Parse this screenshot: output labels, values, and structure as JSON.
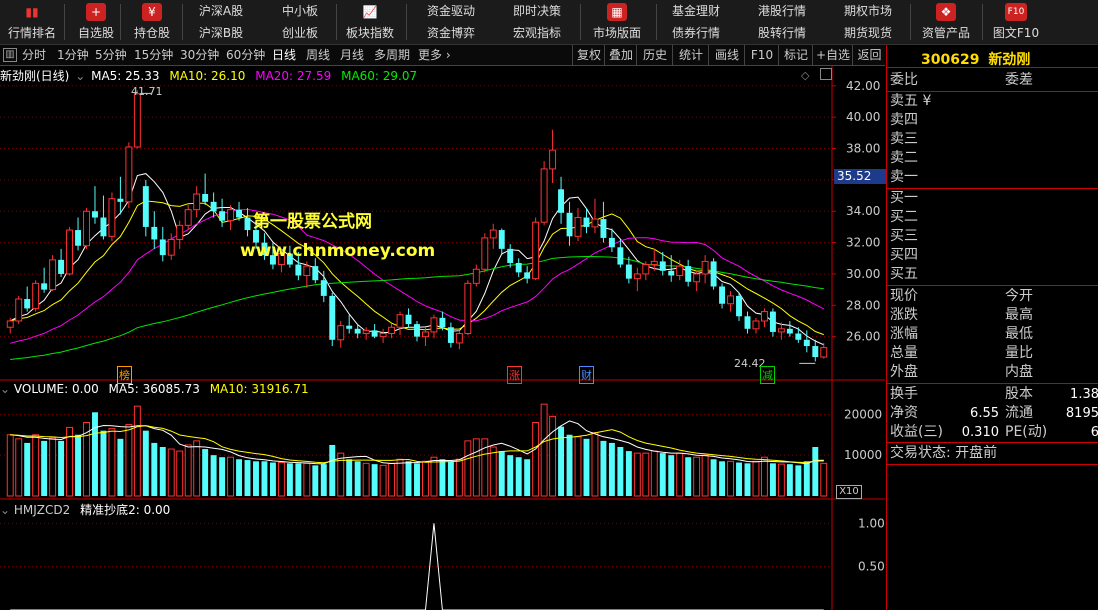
{
  "toolbar": {
    "buttons": [
      {
        "label": "行情排名",
        "icon": "bar-chart-icon"
      },
      {
        "label": "自选股",
        "icon": "plus-icon"
      },
      {
        "label": "持仓股",
        "icon": "yuan-icon"
      }
    ],
    "pairs": [
      {
        "top": "沪深A股",
        "bottom": "沪深B股"
      },
      {
        "top": "中小板",
        "bottom": "创业板"
      }
    ],
    "bankuai": {
      "label": "板块指数",
      "icon": "trend-icon"
    },
    "pairs2": [
      {
        "top": "资金驱动",
        "bottom": "资金博弈"
      },
      {
        "top": "即时决策",
        "bottom": "宏观指标"
      }
    ],
    "market": {
      "label": "市场版面",
      "icon": "store-icon"
    },
    "pairs3": [
      {
        "top": "基金理财",
        "bottom": "债券行情"
      },
      {
        "top": "港股行情",
        "bottom": "股转行情"
      },
      {
        "top": "期权市场",
        "bottom": "期货现货"
      }
    ],
    "assets": {
      "label": "资管产品",
      "icon": "cubes-icon"
    },
    "f10": {
      "label": "图文F10",
      "icon": "f10-icon",
      "icon_text": "F10"
    }
  },
  "periods": [
    "分时",
    "1分钟",
    "5分钟",
    "15分钟",
    "30分钟",
    "60分钟",
    "日线",
    "周线",
    "月线",
    "多周期",
    "更多 ›"
  ],
  "active_period": "日线",
  "right_tools": [
    "复权",
    "叠加",
    "历史",
    "统计",
    "画线",
    "F10",
    "标记",
    "+自选",
    "返回"
  ],
  "stock": {
    "code": "300629",
    "name": "新劲刚",
    "period_label": "新劲刚(日线)"
  },
  "ma_legend": {
    "ma5": "MA5: 25.33",
    "ma10": "MA10: 26.10",
    "ma20": "MA20: 27.59",
    "ma60": "MA60: 29.07"
  },
  "colors": {
    "up": "#ff3232",
    "down": "#54fcfc",
    "ma5": "#ffffff",
    "ma10": "#ffff00",
    "ma20": "#ff00ff",
    "ma60": "#00e600",
    "grid": "#800000"
  },
  "price_axis": [
    "42.00",
    "40.00",
    "38.00",
    "36.00",
    "34.00",
    "32.00",
    "30.00",
    "28.00",
    "26.00"
  ],
  "current_price_tag": "35.52",
  "high_label": "41.71",
  "low_label": "24.42",
  "watermark": {
    "line1": "第一股票公式网",
    "line2": "www.chnmoney.com"
  },
  "markers": [
    {
      "text": "榜",
      "color": "#ff9900"
    },
    {
      "text": "涨",
      "color": "#ff3232"
    },
    {
      "text": "财",
      "color": "#4a8cff"
    },
    {
      "text": "减",
      "color": "#00d000"
    }
  ],
  "volume": {
    "legend": "VOLUME: 0.00",
    "ma5": "MA5: 36085.73",
    "ma10": "MA10: 31916.71",
    "axis": [
      "20000",
      "10000"
    ],
    "unit": "X10"
  },
  "indicator": {
    "name": "HMJZCD2",
    "legend": "精准抄底2: 0.00",
    "axis": [
      "1.00",
      "0.50"
    ]
  },
  "quote": {
    "weibi": "委比",
    "weicha": "委差",
    "sells": [
      "卖五 ¥",
      "卖四",
      "卖三",
      "卖二",
      "卖一"
    ],
    "buys": [
      "买一",
      "买二",
      "买三",
      "买四",
      "买五"
    ],
    "left_labels": [
      "现价",
      "涨跌",
      "涨幅",
      "总量",
      "外盘"
    ],
    "right_labels": [
      "今开",
      "最高",
      "最低",
      "量比",
      "内盘"
    ],
    "huanshou": "换手",
    "guben": "股本",
    "guben_val": "1.38",
    "jingzi": "净资",
    "jingzi_val": "6.55",
    "liutong": "流通",
    "liutong_val": "8195",
    "shouyi": "收益(三)",
    "shouyi_val": "0.310",
    "pe": "PE(动)",
    "pe_val": "6",
    "status": "交易状态: 开盘前"
  },
  "chart_data": {
    "type": "candlestick",
    "candles": [
      [
        26.6,
        27.2,
        26.2,
        27.0
      ],
      [
        27.0,
        28.6,
        26.8,
        28.4
      ],
      [
        28.4,
        29.2,
        27.6,
        27.8
      ],
      [
        27.8,
        29.6,
        27.6,
        29.4
      ],
      [
        29.4,
        30.4,
        28.8,
        29.0
      ],
      [
        29.0,
        31.2,
        28.9,
        30.9
      ],
      [
        30.9,
        31.6,
        29.8,
        30.0
      ],
      [
        30.0,
        33.0,
        29.9,
        32.8
      ],
      [
        32.8,
        33.6,
        31.5,
        31.8
      ],
      [
        31.8,
        34.2,
        31.6,
        34.0
      ],
      [
        34.0,
        35.6,
        33.2,
        33.6
      ],
      [
        33.6,
        35.0,
        32.2,
        32.4
      ],
      [
        32.4,
        35.2,
        32.1,
        34.8
      ],
      [
        34.8,
        36.2,
        33.8,
        34.6
      ],
      [
        34.6,
        38.4,
        34.2,
        38.1
      ],
      [
        38.1,
        41.71,
        38.0,
        41.5
      ],
      [
        35.6,
        36.0,
        32.4,
        33.0
      ],
      [
        33.0,
        34.0,
        31.6,
        32.2
      ],
      [
        32.2,
        33.0,
        30.8,
        31.2
      ],
      [
        31.2,
        32.6,
        30.9,
        32.2
      ],
      [
        32.2,
        33.4,
        31.6,
        33.1
      ],
      [
        33.1,
        34.4,
        32.8,
        34.1
      ],
      [
        34.1,
        35.6,
        33.6,
        35.1
      ],
      [
        35.1,
        36.4,
        34.4,
        34.6
      ],
      [
        34.6,
        35.2,
        33.6,
        34.0
      ],
      [
        34.0,
        34.8,
        33.0,
        33.4
      ],
      [
        33.4,
        34.4,
        32.8,
        34.1
      ],
      [
        34.1,
        34.6,
        33.4,
        33.6
      ],
      [
        33.6,
        34.2,
        32.4,
        32.8
      ],
      [
        32.8,
        33.4,
        31.6,
        32.0
      ],
      [
        32.0,
        32.6,
        30.9,
        31.2
      ],
      [
        31.2,
        32.0,
        30.3,
        30.6
      ],
      [
        30.6,
        31.6,
        30.1,
        31.3
      ],
      [
        31.3,
        31.8,
        30.4,
        30.6
      ],
      [
        30.6,
        31.4,
        29.6,
        29.9
      ],
      [
        29.9,
        30.8,
        29.1,
        30.5
      ],
      [
        30.5,
        31.0,
        29.4,
        29.6
      ],
      [
        29.6,
        30.2,
        28.2,
        28.6
      ],
      [
        28.6,
        28.8,
        25.4,
        25.8
      ],
      [
        25.8,
        27.0,
        25.3,
        26.7
      ],
      [
        26.7,
        27.4,
        26.2,
        26.5
      ],
      [
        26.5,
        26.8,
        25.9,
        26.2
      ],
      [
        26.2,
        26.6,
        25.8,
        26.4
      ],
      [
        26.4,
        26.8,
        25.9,
        26.0
      ],
      [
        26.0,
        26.5,
        25.6,
        26.2
      ],
      [
        26.2,
        26.8,
        25.9,
        26.6
      ],
      [
        26.6,
        27.6,
        26.1,
        27.4
      ],
      [
        27.4,
        27.8,
        26.6,
        26.8
      ],
      [
        26.8,
        27.0,
        25.7,
        26.0
      ],
      [
        26.0,
        26.6,
        25.4,
        26.3
      ],
      [
        26.3,
        27.4,
        25.9,
        27.2
      ],
      [
        27.2,
        27.6,
        26.4,
        26.6
      ],
      [
        26.6,
        26.9,
        25.3,
        25.6
      ],
      [
        25.6,
        26.4,
        25.2,
        26.2
      ],
      [
        26.2,
        29.6,
        26.1,
        29.4
      ],
      [
        29.4,
        30.6,
        29.2,
        30.3
      ],
      [
        30.3,
        32.6,
        30.1,
        32.3
      ],
      [
        32.3,
        33.2,
        31.6,
        32.8
      ],
      [
        32.8,
        32.9,
        31.2,
        31.6
      ],
      [
        31.6,
        31.9,
        30.4,
        30.7
      ],
      [
        30.7,
        31.0,
        29.8,
        30.1
      ],
      [
        30.1,
        30.5,
        29.4,
        29.7
      ],
      [
        29.7,
        33.6,
        29.6,
        33.3
      ],
      [
        33.3,
        37.2,
        33.1,
        36.7
      ],
      [
        36.7,
        39.2,
        35.8,
        37.9
      ],
      [
        35.4,
        36.2,
        33.2,
        33.9
      ],
      [
        33.9,
        34.6,
        31.8,
        32.4
      ],
      [
        32.4,
        34.2,
        32.1,
        33.6
      ],
      [
        33.6,
        34.2,
        32.6,
        33.0
      ],
      [
        33.0,
        34.8,
        32.6,
        33.5
      ],
      [
        33.5,
        34.6,
        32.0,
        32.3
      ],
      [
        32.3,
        32.9,
        31.4,
        31.7
      ],
      [
        31.7,
        32.2,
        30.4,
        30.6
      ],
      [
        30.6,
        31.1,
        29.4,
        29.7
      ],
      [
        29.7,
        30.4,
        28.9,
        30.0
      ],
      [
        30.0,
        30.8,
        29.6,
        30.6
      ],
      [
        30.6,
        31.6,
        30.2,
        30.8
      ],
      [
        30.8,
        31.4,
        29.9,
        30.2
      ],
      [
        30.2,
        31.2,
        29.5,
        29.9
      ],
      [
        29.9,
        30.9,
        29.6,
        30.5
      ],
      [
        30.5,
        30.9,
        29.2,
        29.5
      ],
      [
        29.5,
        30.2,
        28.9,
        30.0
      ],
      [
        30.0,
        31.2,
        29.4,
        30.8
      ],
      [
        30.8,
        31.0,
        29.0,
        29.2
      ],
      [
        29.2,
        29.4,
        27.8,
        28.1
      ],
      [
        28.1,
        28.9,
        27.6,
        28.6
      ],
      [
        28.6,
        28.8,
        27.0,
        27.3
      ],
      [
        27.3,
        27.6,
        26.2,
        26.5
      ],
      [
        26.5,
        27.2,
        26.2,
        27.0
      ],
      [
        27.0,
        27.8,
        26.6,
        27.6
      ],
      [
        27.6,
        27.8,
        26.0,
        26.3
      ],
      [
        26.3,
        26.9,
        25.8,
        26.5
      ],
      [
        26.5,
        27.0,
        26.0,
        26.2
      ],
      [
        26.2,
        26.6,
        25.6,
        25.8
      ],
      [
        25.8,
        26.4,
        25.0,
        25.4
      ],
      [
        25.4,
        25.8,
        24.42,
        24.7
      ],
      [
        24.7,
        25.6,
        24.6,
        25.3
      ]
    ],
    "volume": [
      15000,
      14000,
      13000,
      15000,
      13500,
      14200,
      13500,
      16800,
      15000,
      18000,
      20500,
      16000,
      16500,
      14000,
      17500,
      22000,
      16000,
      13000,
      12000,
      11500,
      11000,
      12500,
      13500,
      11500,
      10000,
      9500,
      9500,
      9000,
      8800,
      8500,
      8500,
      8200,
      8200,
      8000,
      8000,
      8000,
      7500,
      7800,
      12500,
      10500,
      9000,
      8500,
      8000,
      7800,
      7500,
      8000,
      9000,
      8500,
      8000,
      8500,
      9500,
      9000,
      8500,
      9000,
      13500,
      14000,
      14000,
      12000,
      11000,
      10000,
      9500,
      9000,
      18000,
      22500,
      19500,
      17000,
      15000,
      14500,
      14000,
      15500,
      13500,
      13000,
      12000,
      11000,
      10500,
      10500,
      11000,
      10500,
      10000,
      10500,
      9500,
      9500,
      10000,
      9000,
      8500,
      8500,
      8200,
      8000,
      8500,
      9500,
      8000,
      7800,
      7800,
      7500,
      8500,
      12000,
      8000
    ],
    "ma_last": {
      "MA5": 25.33,
      "MA10": 26.1,
      "MA20": 27.59,
      "MA60": 29.07
    },
    "vol_ma_last": {
      "MA5": 36085.73,
      "MA10": 31916.71
    },
    "indicator_peak_index": 50,
    "ylim_price": [
      24.0,
      42.5
    ],
    "ylim_volume": [
      0,
      24000
    ],
    "ylim_indicator": [
      0,
      1.2
    ]
  }
}
